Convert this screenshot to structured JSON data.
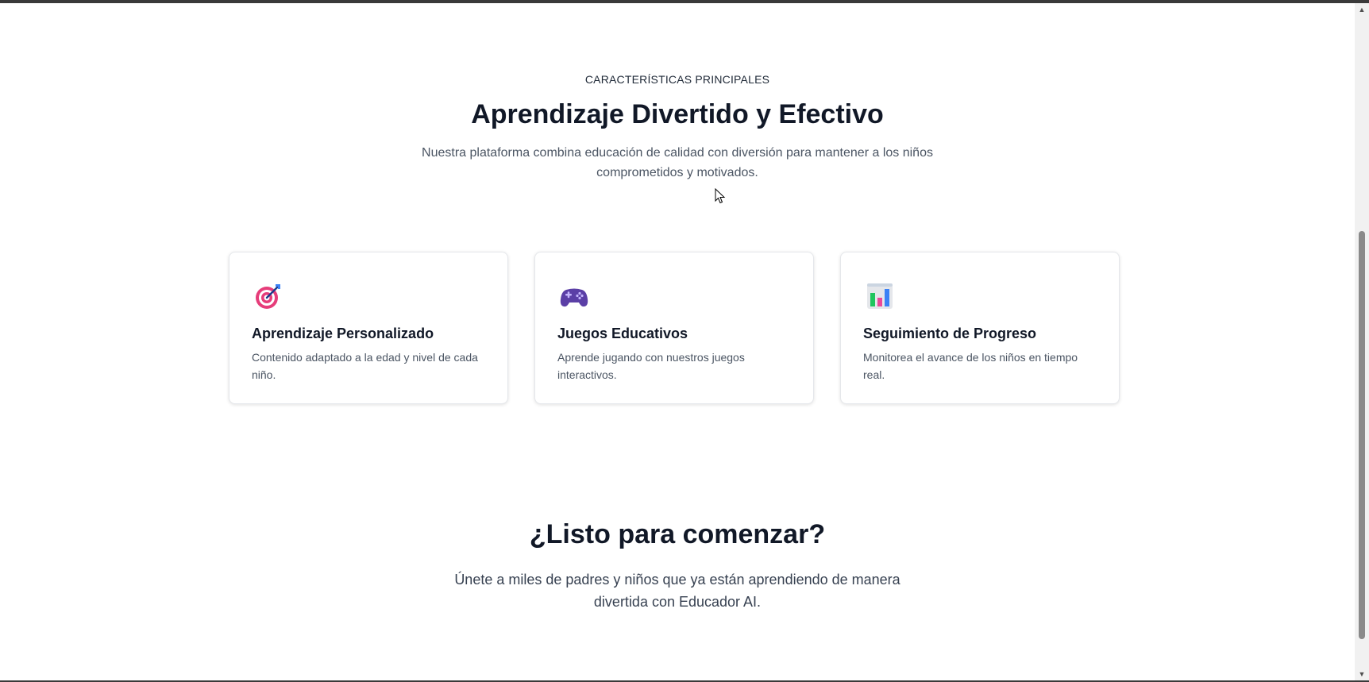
{
  "features": {
    "eyebrow": "CARACTERÍSTICAS PRINCIPALES",
    "title": "Aprendizaje Divertido y Efectivo",
    "subtitle": "Nuestra plataforma combina educación de calidad con diversión para mantener a los niños comprometidos y motivados.",
    "cards": [
      {
        "icon": "target-icon",
        "title": "Aprendizaje Personalizado",
        "description": "Contenido adaptado a la edad y nivel de cada niño."
      },
      {
        "icon": "game-controller-icon",
        "title": "Juegos Educativos",
        "description": "Aprende jugando con nuestros juegos interactivos."
      },
      {
        "icon": "bar-chart-icon",
        "title": "Seguimiento de Progreso",
        "description": "Monitorea el avance de los niños en tiempo real."
      }
    ]
  },
  "cta": {
    "title": "¿Listo para comenzar?",
    "subtitle": "Únete a miles de padres y niños que ya están aprendiendo de manera divertida con Educador AI."
  },
  "colors": {
    "heading": "#111827",
    "body_text": "#4b5563",
    "card_border": "#e5e7eb",
    "target_red": "#e63d7a",
    "controller_purple": "#5b3fa6",
    "chart_blue": "#3b82f6"
  }
}
